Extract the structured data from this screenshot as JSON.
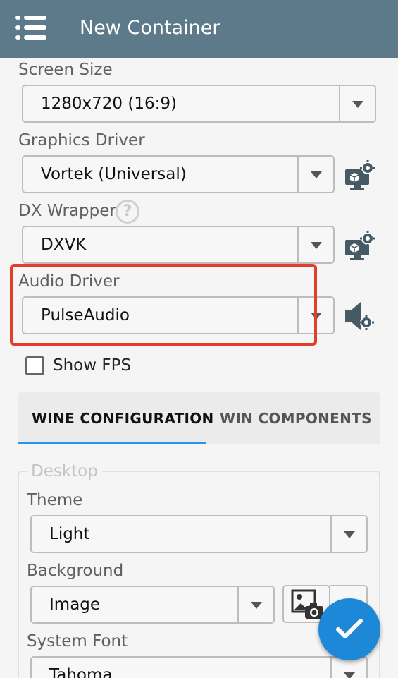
{
  "header": {
    "title": "New Container",
    "menu_icon": "hamburger-menu-icon",
    "background_color": "#5c7a8a"
  },
  "screen_size": {
    "label": "Screen Size",
    "value": "1280x720 (16:9)"
  },
  "graphics_driver": {
    "label": "Graphics Driver",
    "value": "Vortek (Universal)",
    "settings_icon": "display-settings-icon"
  },
  "dx_wrapper": {
    "label": "DX Wrapper",
    "help_icon_glyph": "?",
    "value": "DXVK",
    "settings_icon": "display-settings-icon"
  },
  "audio_driver": {
    "label": "Audio Driver",
    "value": "PulseAudio",
    "settings_icon": "speaker-settings-icon",
    "highlight_color": "#e23e2c"
  },
  "show_fps": {
    "label": "Show FPS",
    "checked": false
  },
  "tabs": [
    {
      "label": "WINE CONFIGURATION",
      "active": true
    },
    {
      "label": "WIN COMPONENTS",
      "active": false
    }
  ],
  "desktop": {
    "legend": "Desktop",
    "theme": {
      "label": "Theme",
      "value": "Light"
    },
    "background": {
      "label": "Background",
      "value": "Image",
      "image_icon": "image-picker-icon"
    },
    "system_font": {
      "label": "System Font",
      "value": "Tahoma"
    }
  },
  "fab": {
    "icon": "checkmark-icon",
    "color": "#1e88d8"
  }
}
